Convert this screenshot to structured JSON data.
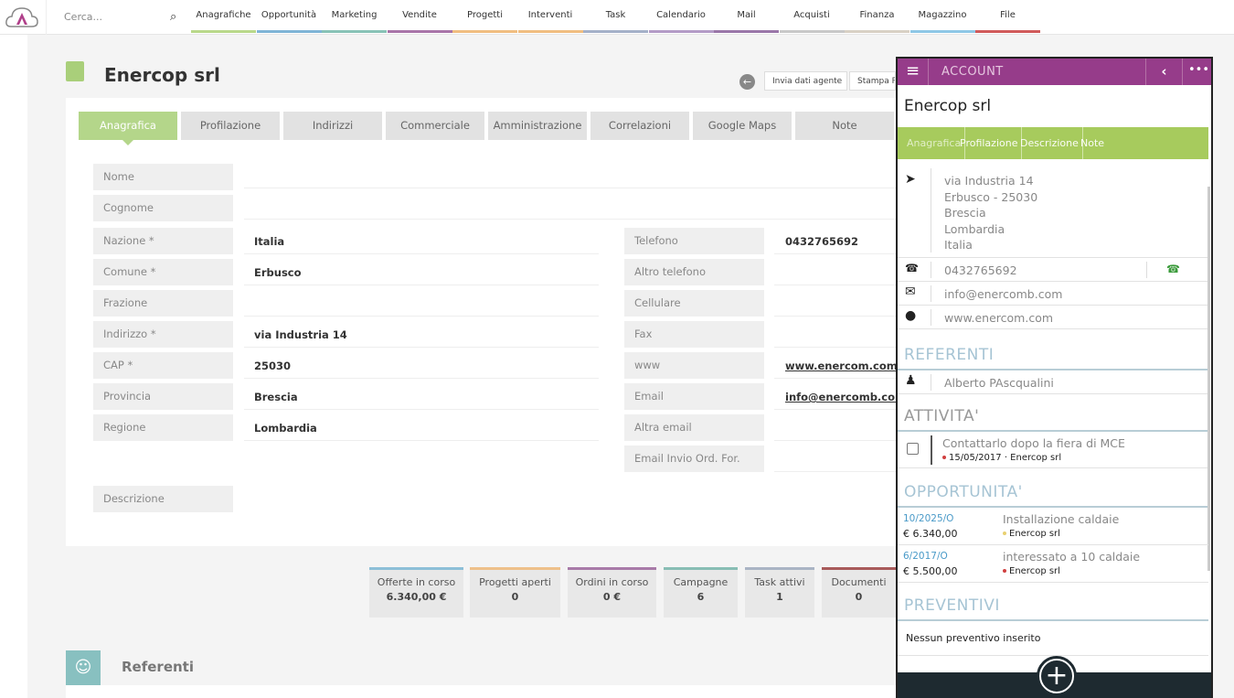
{
  "topbar": {
    "search_placeholder": "Cerca...",
    "nav": [
      {
        "label": "Anagrafiche",
        "color": "#b9d88a"
      },
      {
        "label": "Opportunità",
        "color": "#7fb4d6"
      },
      {
        "label": "Marketing",
        "color": "#88c2b6"
      },
      {
        "label": "Vendite",
        "color": "#a874a8"
      },
      {
        "label": "Progetti",
        "color": "#f0bd80"
      },
      {
        "label": "Interventi",
        "color": "#f0bd80"
      },
      {
        "label": "Task",
        "color": "#a4b0c8"
      },
      {
        "label": "Calendario",
        "color": "#b39bc6"
      },
      {
        "label": "Mail",
        "color": "#9a76a8"
      },
      {
        "label": "Acquisti",
        "color": "#c8c8c8"
      },
      {
        "label": "Finanza",
        "color": "#d8d0c4"
      },
      {
        "label": "Magazzino",
        "color": "#8ec7e6"
      },
      {
        "label": "File",
        "color": "#d05a5a"
      }
    ]
  },
  "page": {
    "title": "Enercop srl",
    "buttons": [
      "Invia dati agente",
      "Stampa P"
    ]
  },
  "tabs": [
    "Anagrafica",
    "Profilazione",
    "Indirizzi",
    "Commerciale",
    "Amministrazione",
    "Correlazioni",
    "Google Maps",
    "Note"
  ],
  "form": {
    "left": [
      {
        "label": "Nazione *",
        "value": "Italia"
      },
      {
        "label": "Comune *",
        "value": "Erbusco"
      },
      {
        "label": "Frazione",
        "value": ""
      },
      {
        "label": "Indirizzo *",
        "value": "via Industria 14"
      },
      {
        "label": "CAP *",
        "value": "25030"
      },
      {
        "label": "Provincia",
        "value": "Brescia"
      },
      {
        "label": "Regione",
        "value": "Lombardia"
      }
    ],
    "top": [
      {
        "label": "Nome",
        "value": ""
      },
      {
        "label": "Cognome",
        "value": ""
      }
    ],
    "right": [
      {
        "label": "Telefono",
        "value": "0432765692"
      },
      {
        "label": "Altro telefono",
        "value": ""
      },
      {
        "label": "Cellulare",
        "value": ""
      },
      {
        "label": "Fax",
        "value": ""
      },
      {
        "label": "www",
        "value": "www.enercom.com"
      },
      {
        "label": "Email",
        "value": "info@enercomb.com"
      },
      {
        "label": "Altra email",
        "value": ""
      },
      {
        "label": "Email Invio Ord. For.",
        "value": ""
      }
    ],
    "descrizione": "Descrizione"
  },
  "stats": [
    {
      "label": "Offerte in corso",
      "value": "6.340,00 €",
      "color": "#8dbfd8"
    },
    {
      "label": "Progetti aperti",
      "value": "0",
      "color": "#eec08a"
    },
    {
      "label": "Ordini in corso",
      "value": "0 €",
      "color": "#a87aa8"
    },
    {
      "label": "Campagne",
      "value": "6",
      "color": "#88bdb4"
    },
    {
      "label": "Task attivi",
      "value": "1",
      "color": "#aab4c4"
    },
    {
      "label": "Documenti",
      "value": "0",
      "color": "#a85a5a"
    }
  ],
  "referenti_title": "Referenti",
  "mobile": {
    "header": "ACCOUNT",
    "name": "Enercop srl",
    "tabs": [
      "Anagrafica",
      "Profilazione",
      "Descrizione",
      "Note"
    ],
    "address": [
      "via Industria 14",
      "Erbusco - 25030",
      "Brescia",
      "Lombardia",
      "Italia"
    ],
    "phone": "0432765692",
    "email": "info@enercomb.com",
    "web": "www.enercom.com",
    "referenti_title": "REFERENTI",
    "referente": "Alberto PAscqualini",
    "attivita_title": "ATTIVITA'",
    "attivita": {
      "title": "Contattarlo dopo la fiera di MCE",
      "meta": "15/05/2017 · Enercop srl"
    },
    "opportunita_title": "OPPORTUNITA'",
    "opportunita": [
      {
        "code": "10/2025/O",
        "amount": "€ 6.340,00",
        "title": "Installazione caldaie",
        "account": "Enercop srl",
        "dot": "#e8d070"
      },
      {
        "code": "6/2017/O",
        "amount": "€ 5.500,00",
        "title": "interessato a 10 caldaie",
        "account": "Enercop srl",
        "dot": "#d04040"
      }
    ],
    "preventivi_title": "PREVENTIVI",
    "preventivi_empty": "Nessun preventivo inserito"
  }
}
